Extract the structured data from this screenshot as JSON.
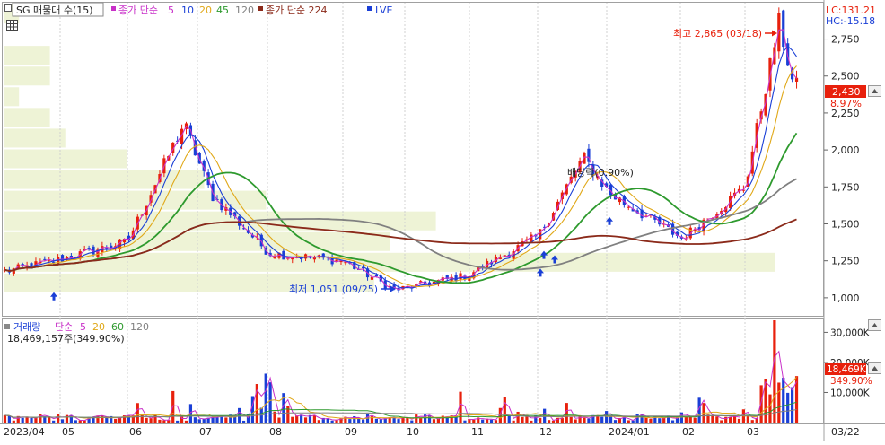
{
  "toolbar": {
    "series_name": "SG 매물대 수(15)",
    "ma_label": "종가 단순",
    "ma_periods": [
      "5",
      "10",
      "20",
      "45",
      "120"
    ],
    "ma2_label": "종가 단순 224",
    "lve_label": "LVE"
  },
  "info_corner": {
    "lc": "LC:131.21",
    "hc": "HC:-15.18"
  },
  "annotations": {
    "high": "최고 2,865 (03/18)",
    "low": "최저 1,051 (09/25)",
    "dividend": "배당락(0.90%)"
  },
  "price_badge": {
    "price": "2,430",
    "pct": "8.97%"
  },
  "volume_panel": {
    "legend_label": "거래량",
    "ma_label": "단순",
    "ma_periods": [
      "5",
      "20",
      "60",
      "120"
    ],
    "value": "18,469,157주(349.90%)",
    "badge_value": "18,469K",
    "badge_pct": "349.90%"
  },
  "colors": {
    "up": "#e8200c",
    "down": "#1a3fd6",
    "ma5": "#c830c8",
    "ma10": "#1a3fd6",
    "ma20": "#e0a818",
    "ma45": "#2e9a2e",
    "ma120": "#808080",
    "ma224": "#8b2a1a",
    "profile": "#eef3d6",
    "arrow": "#1a3fd6"
  },
  "chart_data": [
    {
      "type": "candlestick",
      "title": "",
      "y_ticks": [
        "2,750",
        "2,500",
        "2,250",
        "2,000",
        "1,750",
        "1,500",
        "1,250",
        "1,000"
      ],
      "y_tick_values": [
        2750,
        2500,
        2250,
        2000,
        1750,
        1500,
        1250,
        1000
      ],
      "ylim": [
        890,
        2990
      ],
      "x_labels": [
        "2023/04",
        "05",
        "06",
        "07",
        "08",
        "09",
        "10",
        "11",
        "12",
        "2024/01",
        "02",
        "03",
        "03/22"
      ],
      "key_points": [
        {
          "date": "2023/04",
          "price": 1180
        },
        {
          "date": "2023/05",
          "price": 1260
        },
        {
          "date": "2023/06",
          "price": 1380
        },
        {
          "date": "2023/06 end",
          "price": 2180
        },
        {
          "date": "2023/07",
          "price": 1700
        },
        {
          "date": "2023/08",
          "price": 1300
        },
        {
          "date": "2023/09",
          "price": 1250
        },
        {
          "date": "2023/09/25",
          "price": 1051
        },
        {
          "date": "2023/11",
          "price": 1150
        },
        {
          "date": "2023/12",
          "price": 1420
        },
        {
          "date": "2023/12 end",
          "price": 1950
        },
        {
          "date": "2024/01",
          "price": 1700
        },
        {
          "date": "2024/02",
          "price": 1400
        },
        {
          "date": "2024/03",
          "price": 1750
        },
        {
          "date": "2024/03/18",
          "price": 2865
        },
        {
          "date": "2024/03/22",
          "price": 2430
        }
      ],
      "last_price": 2430,
      "high": {
        "date": "03/18",
        "price": 2865
      },
      "low": {
        "date": "09/25",
        "price": 1051
      },
      "volume_profile_bins": 15
    },
    {
      "type": "bar",
      "title": "",
      "y_ticks": [
        "30,000K",
        "20,000K",
        "10,000K"
      ],
      "y_tick_values": [
        30000,
        20000,
        10000
      ],
      "ylim": [
        0,
        34000
      ],
      "last_volume_k": 18469
    }
  ]
}
